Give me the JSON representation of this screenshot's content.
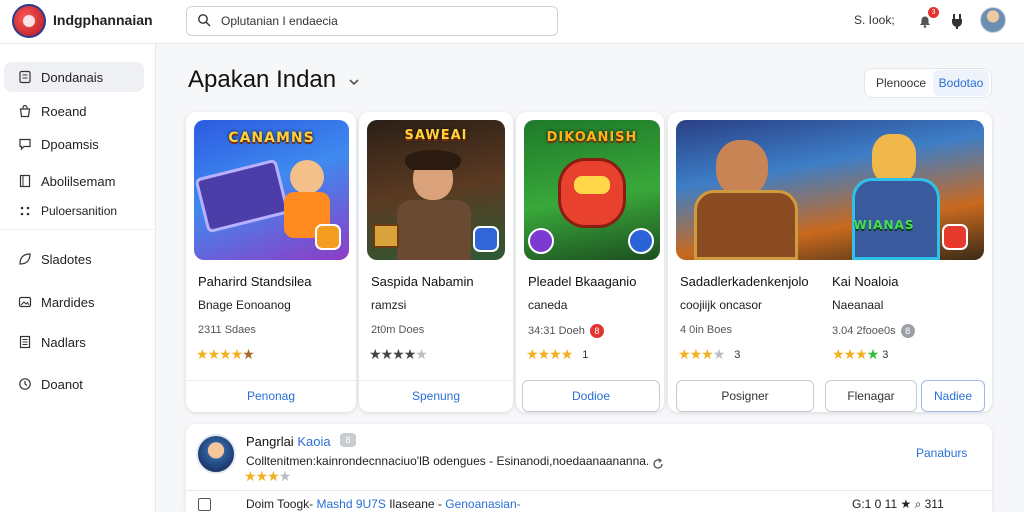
{
  "header": {
    "app_name": "Indgphannaian",
    "search_value": "Oplutanian I endaecia",
    "right_text": "S. Iook;",
    "notif_count": "3",
    "icons": [
      "search-icon",
      "bell-icon",
      "plug-icon",
      "avatar"
    ]
  },
  "sidebar": {
    "items": [
      {
        "label": "Dondanais",
        "icon": "file-icon"
      },
      {
        "label": "Roeand",
        "icon": "bag-icon"
      },
      {
        "label": "Dpoamsis",
        "icon": "chat-icon"
      },
      {
        "label": "Abolilsemam",
        "icon": "book-icon"
      },
      {
        "label": "Puloersanition",
        "icon": "grid-icon"
      },
      {
        "label": "Sladotes",
        "icon": "leaf-icon"
      },
      {
        "label": "Mardides",
        "icon": "image-icon"
      },
      {
        "label": "Nadlars",
        "icon": "document-icon"
      },
      {
        "label": "Doanot",
        "icon": "clock-icon"
      }
    ]
  },
  "main": {
    "title": "Apakan Indan",
    "toggle": {
      "option_a": "Plenooce",
      "option_b": "Bodotao"
    }
  },
  "cards": [
    {
      "art_title": "CANAMNS",
      "name": "Paharird Standsilea",
      "sub": "Bnage Eonoanog",
      "meta": "2311 Sdaes",
      "rating": 4.5,
      "rating_label": "",
      "button": "Penonag"
    },
    {
      "art_title": "SAWEAI",
      "name": "Saspida Nabamin",
      "sub": "ramzsi",
      "meta": "2t0m Does",
      "rating": 3.5,
      "rating_label": "",
      "button": "Spenung"
    },
    {
      "art_title": "DIKOANISH",
      "name": "Pleadel Bkaaganio",
      "sub": "caneda",
      "meta": "34:31 Doeh",
      "meta_badge": "8",
      "rating": 4,
      "rating_label": "1",
      "button": "Dodioe"
    },
    {
      "art_title": "WIANAS",
      "name": "Sadadlerkadenkenjolo",
      "sub": "coojiijk oncasor",
      "meta": "4 0in Boes",
      "rating": 3,
      "rating_label": "3",
      "button": "Posigner"
    },
    {
      "art_title": "",
      "name": "Kai Noaloia",
      "sub": "Naeanaal",
      "meta": "3.04 2fooe0s",
      "meta_badge": "8",
      "rating": 3.5,
      "rating_label": "3",
      "button_a": "Flenagar",
      "button_b": "Nadiee"
    }
  ],
  "bottom": {
    "title": "Pangrlai",
    "tag": "Kaoia",
    "pill": "8",
    "description": "Colltenitmen:kainrondecnnaciuo'lB odengues - Esinanodi,noedaanaananna.",
    "rating": 3,
    "link": "Panaburs",
    "row_text": "Doim Toogk-",
    "row_blue": "Mashd 9U7S",
    "row_text2": "Ilaseane -",
    "row_blue2": "Genoanasian-",
    "row_right": "G:1 0 11    ★    ⌕    311"
  }
}
